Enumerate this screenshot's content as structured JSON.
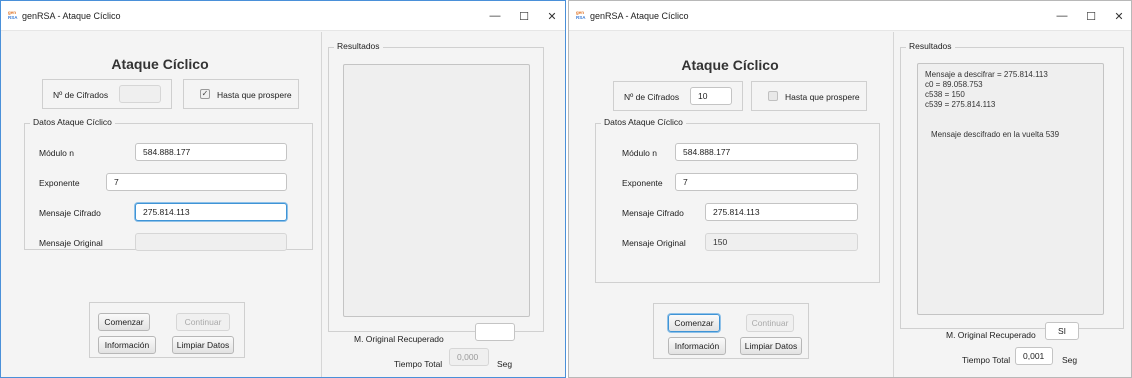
{
  "windows": [
    {
      "title": "genRSA - Ataque Cíclico",
      "app_icon_top": "gen",
      "app_icon_bottom": "RSA",
      "heading": "Ataque Cíclico",
      "cifrados": {
        "label": "Nº de Cifrados",
        "value": "",
        "enabled": false
      },
      "hasta": {
        "label": "Hasta que prospere",
        "checked": true,
        "glyph": "✓"
      },
      "datos": {
        "title": "Datos Ataque Cíclico",
        "modulo_label": "Módulo n",
        "modulo_value": "584.888.177",
        "exponente_label": "Exponente",
        "exponente_value": "7",
        "cifrado_label": "Mensaje Cifrado",
        "cifrado_value": "275.814.113",
        "original_label": "Mensaje Original",
        "original_value": ""
      },
      "buttons": {
        "comenzar": "Comenzar",
        "continuar": "Continuar",
        "informacion": "Información",
        "limpiar": "Limpiar Datos"
      },
      "results": {
        "title": "Resultados",
        "lines": [],
        "recuperado_label": "M. Original Recuperado",
        "recuperado_value": "",
        "tiempo_label": "Tiempo Total",
        "tiempo_value": "0,000",
        "tiempo_unit": "Seg"
      }
    },
    {
      "title": "genRSA - Ataque Cíclico",
      "app_icon_top": "gen",
      "app_icon_bottom": "RSA",
      "heading": "Ataque Cíclico",
      "cifrados": {
        "label": "Nº de Cifrados",
        "value": "10",
        "enabled": true
      },
      "hasta": {
        "label": "Hasta que prospere",
        "checked": false,
        "glyph": ""
      },
      "datos": {
        "title": "Datos Ataque Cíclico",
        "modulo_label": "Módulo n",
        "modulo_value": "584.888.177",
        "exponente_label": "Exponente",
        "exponente_value": "7",
        "cifrado_label": "Mensaje Cifrado",
        "cifrado_value": "275.814.113",
        "original_label": "Mensaje Original",
        "original_value": "150"
      },
      "buttons": {
        "comenzar": "Comenzar",
        "continuar": "Continuar",
        "informacion": "Información",
        "limpiar": "Limpiar Datos"
      },
      "results": {
        "title": "Resultados",
        "lines": [
          "Mensaje a descifrar = 275.814.113",
          "c0 = 89.058.753",
          "c538 = 150",
          "c539 = 275.814.113",
          "",
          "Mensaje descifrado en la vuelta 539"
        ],
        "recuperado_label": "M. Original Recuperado",
        "recuperado_value": "SI",
        "tiempo_label": "Tiempo Total",
        "tiempo_value": "0,001",
        "tiempo_unit": "Seg"
      }
    }
  ],
  "window_controls": {
    "minimize": "—",
    "maximize": "☐",
    "close": "✕"
  }
}
